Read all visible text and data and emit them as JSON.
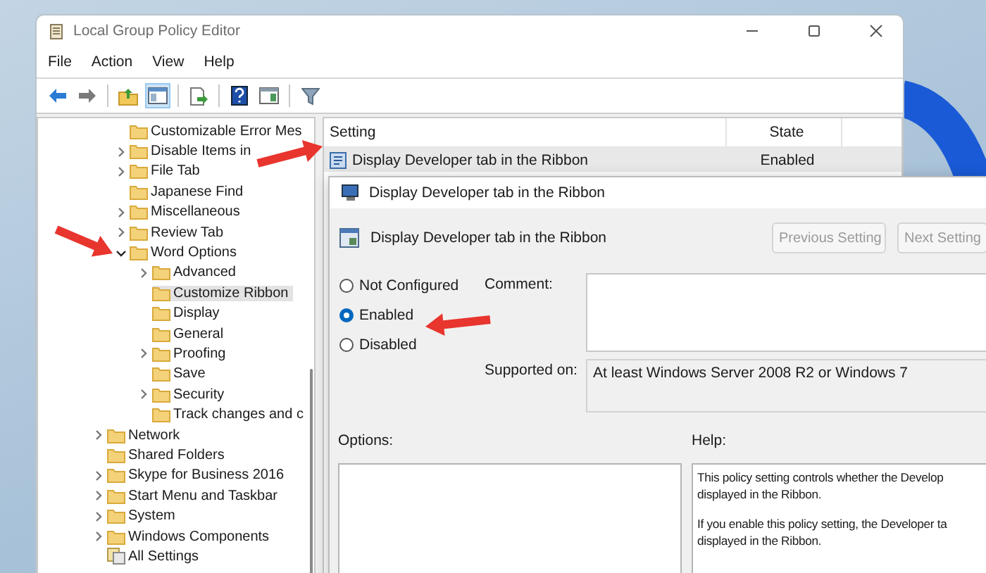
{
  "window": {
    "title": "Local Group Policy Editor"
  },
  "menu": [
    "File",
    "Action",
    "View",
    "Help"
  ],
  "toolbar": [
    {
      "kind": "back",
      "pressed": false
    },
    {
      "kind": "forward",
      "pressed": false
    },
    {
      "kind": "separator"
    },
    {
      "kind": "up-folder",
      "pressed": false
    },
    {
      "kind": "tree-toggle",
      "pressed": true
    },
    {
      "kind": "separator"
    },
    {
      "kind": "export",
      "pressed": false
    },
    {
      "kind": "separator"
    },
    {
      "kind": "help",
      "pressed": false
    },
    {
      "kind": "panel",
      "pressed": false
    },
    {
      "kind": "separator"
    },
    {
      "kind": "filter",
      "pressed": false
    }
  ],
  "tree": {
    "scrolled_branch": [
      {
        "label": "Customizable Error Mes",
        "kind": "folder",
        "expandable": false,
        "selected": false
      },
      {
        "label": "Disable Items in",
        "kind": "folder",
        "expandable": true,
        "expanded": false,
        "selected": false
      },
      {
        "label": "File Tab",
        "kind": "folder",
        "expandable": true,
        "expanded": false,
        "selected": false
      },
      {
        "label": "Japanese Find",
        "kind": "folder",
        "expandable": false,
        "selected": false
      },
      {
        "label": "Miscellaneous",
        "kind": "folder",
        "expandable": true,
        "expanded": false,
        "selected": false
      },
      {
        "label": "Review Tab",
        "kind": "folder",
        "expandable": true,
        "expanded": false,
        "selected": false
      },
      {
        "label": "Word Options",
        "kind": "folder",
        "expandable": true,
        "expanded": true,
        "selected": false,
        "children": [
          {
            "label": "Advanced",
            "kind": "folder",
            "expandable": true,
            "expanded": false,
            "selected": false
          },
          {
            "label": "Customize Ribbon",
            "kind": "folder",
            "expandable": false,
            "selected": true
          },
          {
            "label": "Display",
            "kind": "folder",
            "expandable": false,
            "selected": false
          },
          {
            "label": "General",
            "kind": "folder",
            "expandable": false,
            "selected": false
          },
          {
            "label": "Proofing",
            "kind": "folder",
            "expandable": true,
            "expanded": false,
            "selected": false
          },
          {
            "label": "Save",
            "kind": "folder",
            "expandable": false,
            "selected": false
          },
          {
            "label": "Security",
            "kind": "folder",
            "expandable": true,
            "expanded": false,
            "selected": false
          },
          {
            "label": "Track changes and c",
            "kind": "folder",
            "expandable": false,
            "selected": false
          }
        ]
      }
    ],
    "items": [
      {
        "label": "Network",
        "kind": "folder",
        "expandable": true,
        "expanded": false,
        "selected": false
      },
      {
        "label": "Shared Folders",
        "kind": "folder",
        "expandable": false,
        "selected": false
      },
      {
        "label": "Skype for Business 2016",
        "kind": "folder",
        "expandable": true,
        "expanded": false,
        "selected": false
      },
      {
        "label": "Start Menu and Taskbar",
        "kind": "folder",
        "expandable": true,
        "expanded": false,
        "selected": false
      },
      {
        "label": "System",
        "kind": "folder",
        "expandable": true,
        "expanded": false,
        "selected": false
      },
      {
        "label": "Windows Components",
        "kind": "folder",
        "expandable": true,
        "expanded": false,
        "selected": false
      },
      {
        "label": "All Settings",
        "kind": "settings",
        "expandable": false,
        "selected": false
      }
    ]
  },
  "list": {
    "columns": [
      "Setting",
      "State"
    ],
    "rows": [
      {
        "setting": "Display Developer tab in the Ribbon",
        "state": "Enabled",
        "selected": true
      }
    ]
  },
  "dialog": {
    "title": "Display Developer tab in the Ribbon",
    "heading": "Display Developer tab in the Ribbon",
    "buttons": [
      {
        "label": "Previous Setting",
        "disabled": true
      },
      {
        "label": "Next Setting",
        "disabled": true
      }
    ],
    "options": [
      {
        "label": "Not Configured",
        "selected": false
      },
      {
        "label": "Enabled",
        "selected": true
      },
      {
        "label": "Disabled",
        "selected": false
      }
    ],
    "comment_label": "Comment:",
    "supported_label": "Supported on:",
    "supported_value": "At least Windows Server 2008 R2 or Windows 7",
    "options_label": "Options:",
    "help_label": "Help:",
    "help": [
      [
        "This policy setting controls whether the Develop",
        "displayed in the Ribbon."
      ],
      [
        "If you enable this policy setting, the Developer ta",
        "displayed in the Ribbon."
      ]
    ]
  }
}
